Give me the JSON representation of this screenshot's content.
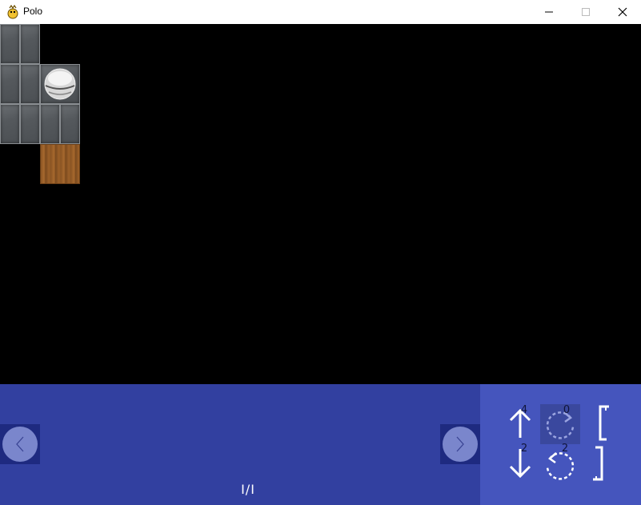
{
  "window": {
    "title": "Polo",
    "controls": [
      "minimize",
      "maximize",
      "close"
    ]
  },
  "board": {
    "tiles": [
      {
        "type": "stone"
      },
      {
        "type": "stone"
      },
      {
        "type": "stone"
      },
      {
        "type": "stone"
      },
      {
        "type": "stone-ball"
      },
      {
        "type": "stone"
      },
      {
        "type": "stone"
      },
      {
        "type": "stone"
      },
      {
        "type": "stone"
      },
      {
        "type": "wood"
      }
    ],
    "background": "#000000"
  },
  "panel": {
    "page_indicator": "I/I",
    "prev_icon": "chevron-left-icon",
    "next_icon": "chevron-right-icon",
    "color": "#3240a0"
  },
  "controls": {
    "move_up_count": "4",
    "rotate_cw_count": "0",
    "move_down_count": "2",
    "rotate_ccw_count": "2",
    "selected": "rotate_cw",
    "color": "#4555bd"
  }
}
